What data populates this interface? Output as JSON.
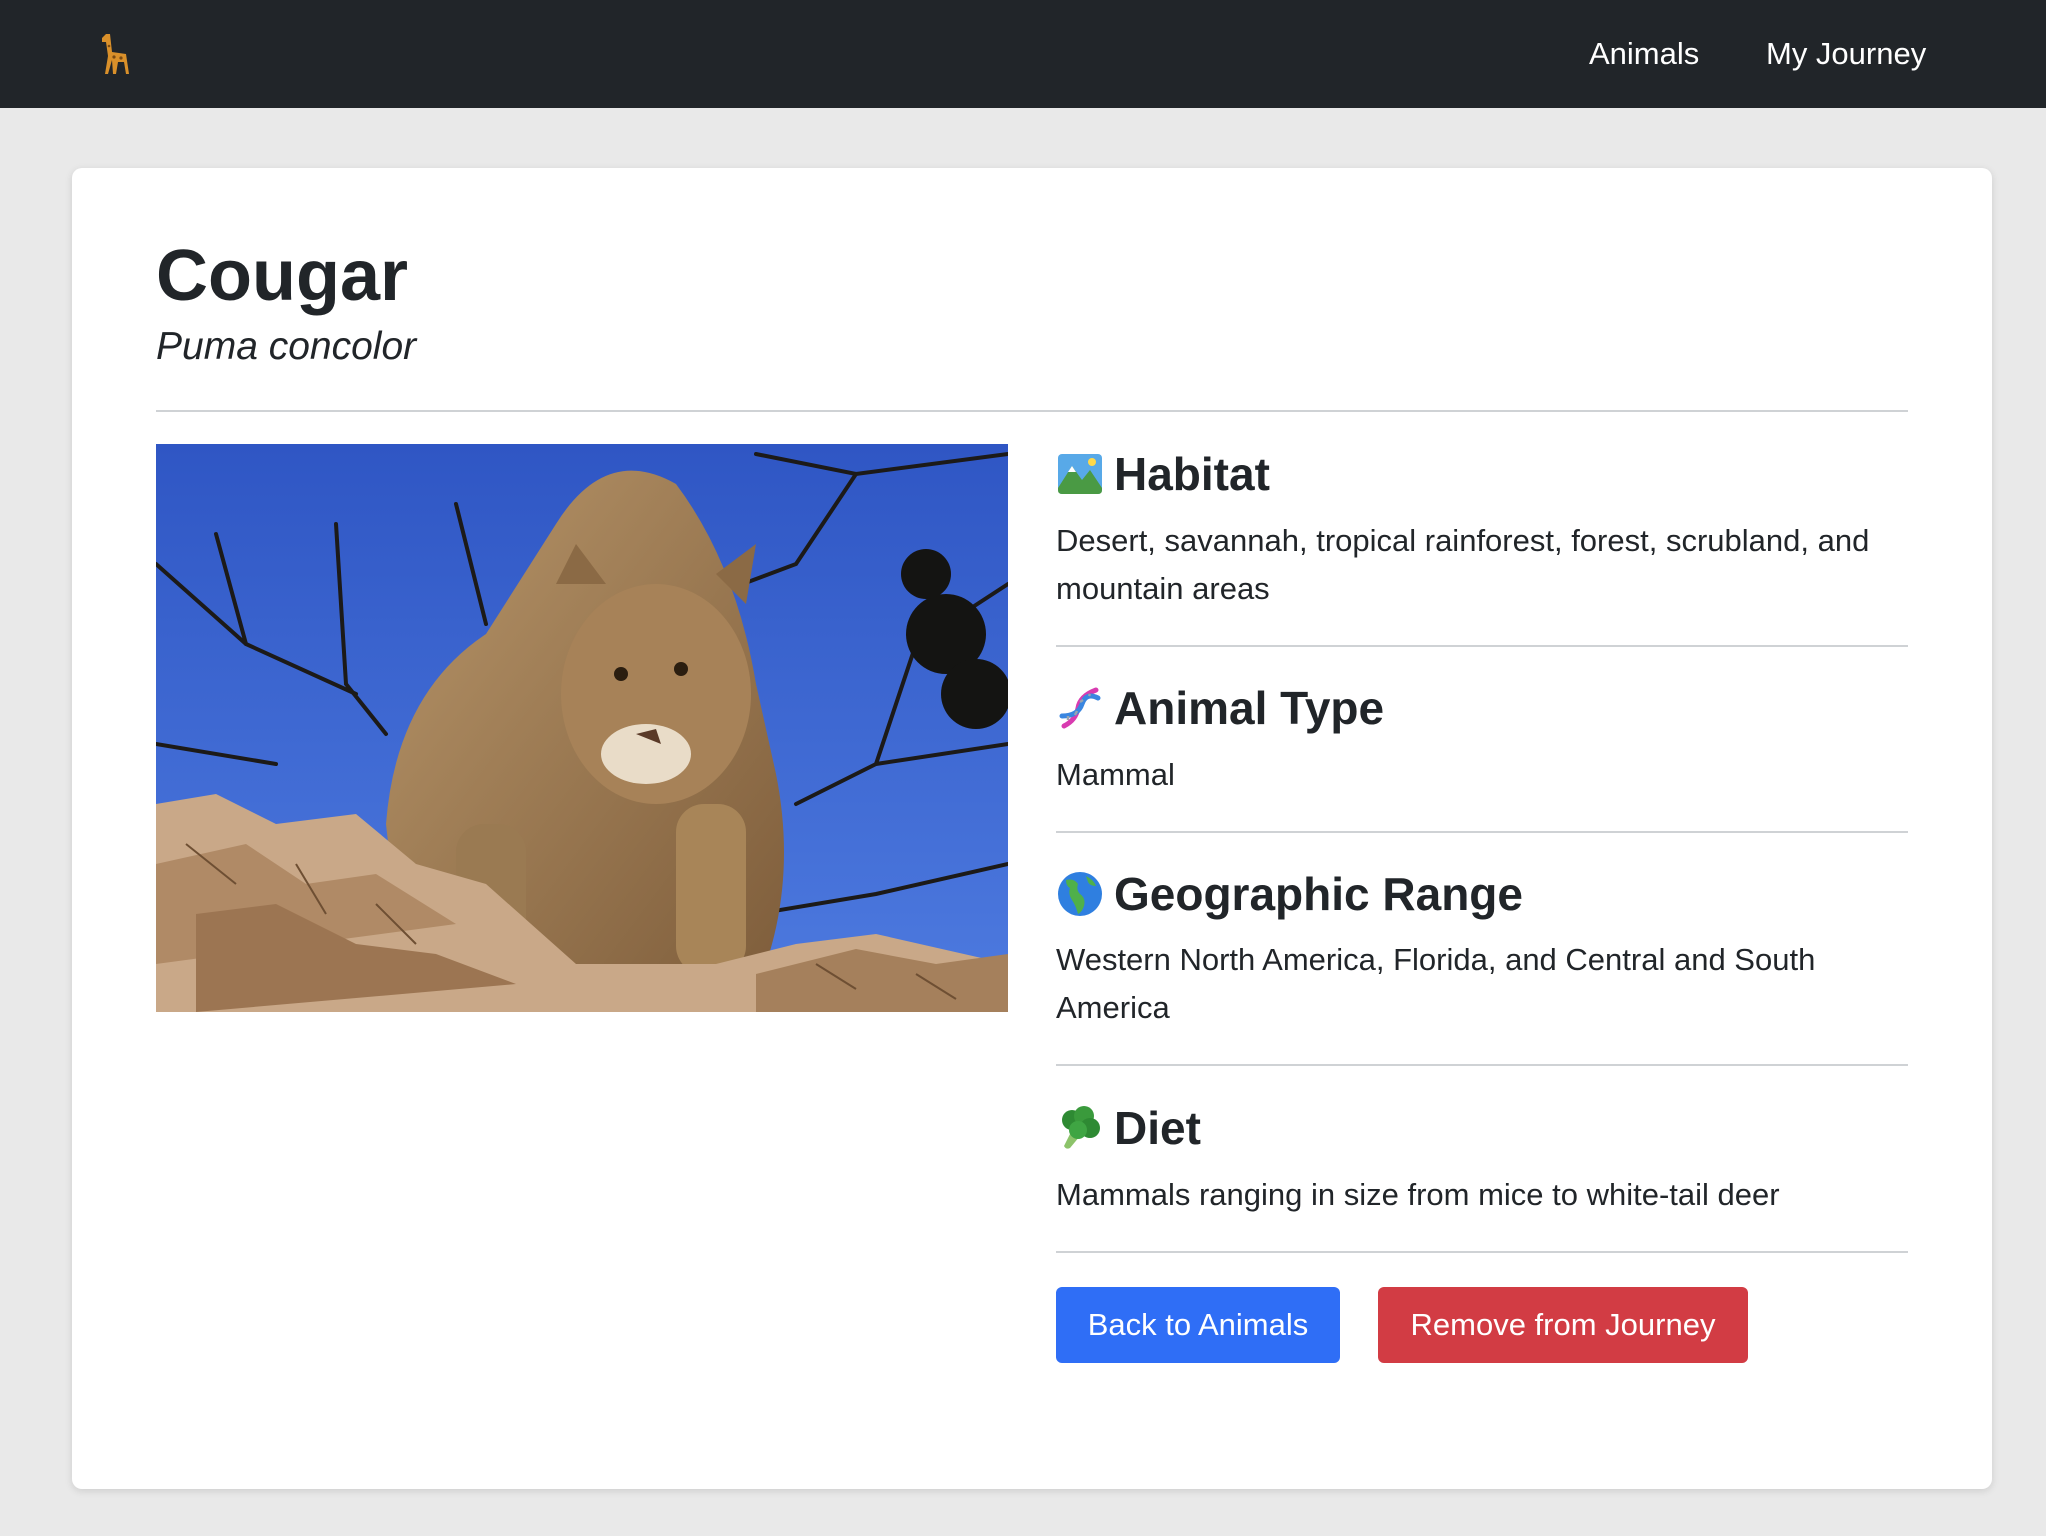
{
  "navbar": {
    "brand_icon": "giraffe-icon",
    "links": [
      {
        "label": "Animals"
      },
      {
        "label": "My Journey"
      }
    ]
  },
  "animal": {
    "name": "Cougar",
    "scientific_name": "Puma concolor",
    "photo_subject": "cougar-photo"
  },
  "sections": [
    {
      "icon": "mountain-landscape-icon",
      "title": "Habitat",
      "text": "Desert, savannah, tropical rainforest, forest, scrubland, and mountain areas"
    },
    {
      "icon": "dna-icon",
      "title": "Animal Type",
      "text": "Mammal"
    },
    {
      "icon": "globe-americas-icon",
      "title": "Geographic Range",
      "text": "Western North America, Florida, and Central and South America"
    },
    {
      "icon": "broccoli-icon",
      "title": "Diet",
      "text": "Mammals ranging in size from mice to white-tail deer"
    }
  ],
  "actions": {
    "back_label": "Back to Animals",
    "remove_label": "Remove from Journey"
  },
  "colors": {
    "navbar_bg": "#212529",
    "primary_button": "#2f6ef6",
    "danger_button": "#d23c44",
    "page_bg": "#e9e9e9"
  }
}
